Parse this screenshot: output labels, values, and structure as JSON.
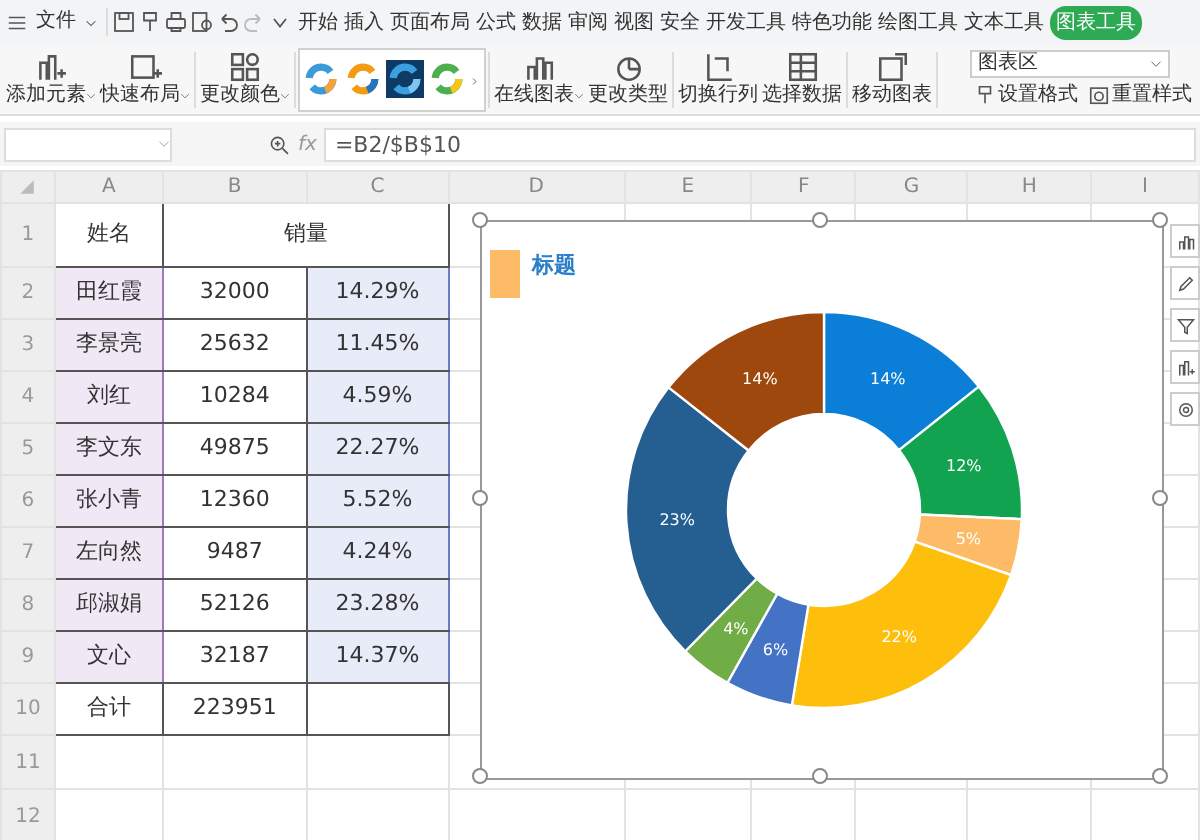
{
  "ribbon": {
    "file_menu": "文件",
    "tabs": [
      {
        "label": "开始",
        "selected": false
      },
      {
        "label": "插入",
        "selected": false
      },
      {
        "label": "页面布局",
        "selected": false
      },
      {
        "label": "公式",
        "selected": false
      },
      {
        "label": "数据",
        "selected": false
      },
      {
        "label": "审阅",
        "selected": false
      },
      {
        "label": "视图",
        "selected": false
      },
      {
        "label": "安全",
        "selected": false
      },
      {
        "label": "开发工具",
        "selected": false
      },
      {
        "label": "特色功能",
        "selected": false
      },
      {
        "label": "绘图工具",
        "selected": false
      },
      {
        "label": "文本工具",
        "selected": false
      },
      {
        "label": "图表工具",
        "selected": true
      }
    ],
    "toolbar": [
      {
        "kind": "group",
        "buttons": [
          {
            "label": "添加元素",
            "dropdown": true
          },
          {
            "label": "快速布局",
            "dropdown": true
          }
        ]
      },
      {
        "kind": "group",
        "buttons": [
          {
            "label": "更改颜色",
            "dropdown": true
          }
        ]
      },
      {
        "kind": "gallery"
      },
      {
        "kind": "group",
        "buttons": [
          {
            "label": "在线图表",
            "dropdown": true
          },
          {
            "label": "更改类型",
            "dropdown": false
          }
        ]
      },
      {
        "kind": "group",
        "buttons": [
          {
            "label": "切换行列",
            "dropdown": false
          },
          {
            "label": "选择数据",
            "dropdown": false
          }
        ]
      },
      {
        "kind": "group",
        "buttons": [
          {
            "label": "移动图表",
            "dropdown": false
          }
        ]
      },
      {
        "kind": "format_panel",
        "dropdown_value": "图表区",
        "buttons": [
          "设置格式",
          "重置样式"
        ]
      }
    ]
  },
  "formula_bar": {
    "fx_label": "fx",
    "formula": "=B2/$B$10"
  },
  "sheet": {
    "columns": [
      "A",
      "B",
      "C",
      "D",
      "E",
      "F",
      "G",
      "H",
      "I"
    ],
    "row_numbers": [
      "1",
      "2",
      "3",
      "4",
      "5",
      "6",
      "7",
      "8",
      "9",
      "10",
      "11",
      "12"
    ],
    "header": {
      "name": "姓名",
      "sales": "销量"
    },
    "rows": [
      [
        "田红霞",
        "32000",
        "14.29%"
      ],
      [
        "李景亮",
        "25632",
        "11.45%"
      ],
      [
        "刘红",
        "10284",
        "4.59%"
      ],
      [
        "李文东",
        "49875",
        "22.27%"
      ],
      [
        "张小青",
        "12360",
        "5.52%"
      ],
      [
        "左向然",
        "9487",
        "4.24%"
      ],
      [
        "邱淑娟",
        "52126",
        "23.28%"
      ],
      [
        "文心",
        "32187",
        "14.37%"
      ]
    ],
    "total": {
      "label": "合计",
      "value": "223951"
    }
  },
  "chart": {
    "chart_data": {
      "type": "donut",
      "title": "标题",
      "series": [
        {
          "values": [
            14.29,
            11.45,
            4.59,
            22.27,
            5.52,
            4.24,
            23.28,
            14.37
          ]
        }
      ],
      "value_labels": [
        "14%",
        "12%",
        "5%",
        "22%",
        "6%",
        "4%",
        "23%",
        "14%"
      ]
    }
  }
}
